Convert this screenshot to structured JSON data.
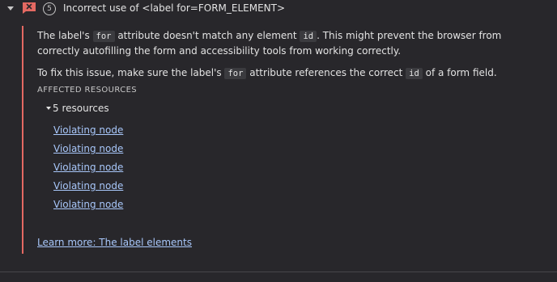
{
  "issue": {
    "count": "5",
    "title": "Incorrect use of <label for=FORM_ELEMENT>",
    "colors": {
      "accent_error": "#e46962",
      "link": "#a8c7fa",
      "background": "#28272b"
    },
    "description": {
      "p1_a": "The label's ",
      "p1_code1": "for",
      "p1_b": " attribute doesn't match any element ",
      "p1_code2": "id",
      "p1_c": ". This might prevent the browser from correctly autofilling the form and accessibility tools from working correctly.",
      "p2_a": "To fix this issue, make sure the label's ",
      "p2_code1": "for",
      "p2_b": " attribute references the correct ",
      "p2_code2": "id",
      "p2_c": " of a form field."
    },
    "affected_heading": "AFFECTED RESOURCES",
    "resources_label": "5 resources",
    "nodes": [
      "Violating node",
      "Violating node",
      "Violating node",
      "Violating node",
      "Violating node"
    ],
    "learn_more": "Learn more: The label elements"
  }
}
